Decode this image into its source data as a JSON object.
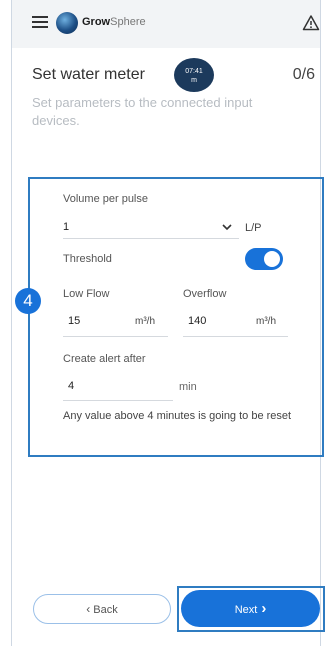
{
  "header": {
    "brand_bold": "Grow",
    "brand_light": "Sphere"
  },
  "page": {
    "title": "Set water meter",
    "counter": "0/6",
    "time_badge_line1": "07:41",
    "time_badge_line2": "m",
    "subtitle": "Set parameters to the connected input devices."
  },
  "form": {
    "volume_label": "Volume per pulse",
    "volume_value": "1",
    "volume_unit": "L/P",
    "threshold_label": "Threshold",
    "threshold_on": true,
    "low_flow_label": "Low Flow",
    "low_flow_value": "15",
    "low_flow_unit": "m³/h",
    "overflow_label": "Overflow",
    "overflow_value": "140",
    "overflow_unit": "m³/h",
    "alert_label": "Create alert after",
    "alert_value": "4",
    "alert_unit": "min",
    "note": "Any value above 4 minutes is going to be reset"
  },
  "step_badge": "4",
  "footer": {
    "back_label": "Back",
    "next_label": "Next"
  },
  "colors": {
    "primary": "#1872d9",
    "highlight_frame": "#2f7cc1",
    "header_bg": "#f2f4f6"
  }
}
